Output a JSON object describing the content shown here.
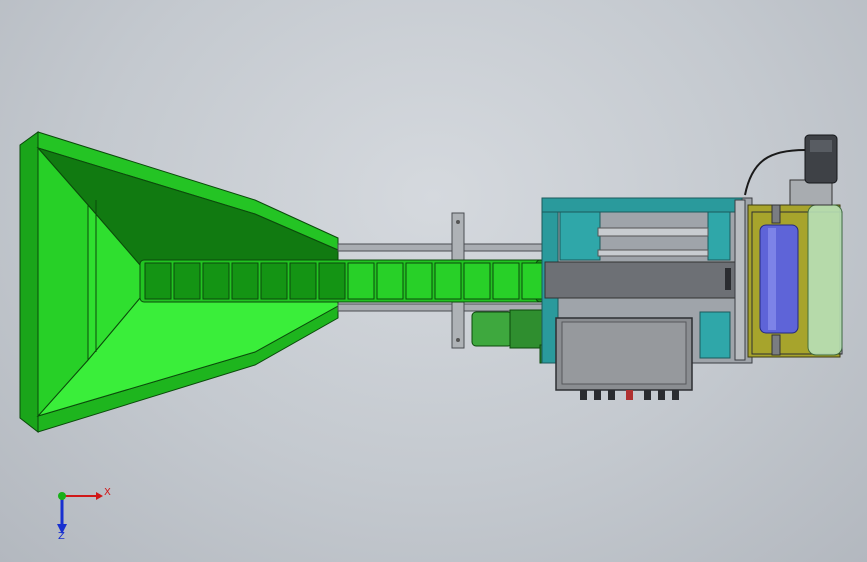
{
  "viewport": {
    "background": "#c6cbd1"
  },
  "model": {
    "hopper_color": "#1fb81f",
    "hopper_dark": "#0f6e0f",
    "hopper_light": "#39f039",
    "conveyor_color": "#22c422",
    "frame_color": "#2a9a9c",
    "motor_color": "#3c9c3c",
    "cabinet_color": "#8a8d91",
    "roller_color": "#5e64d8",
    "plate_color": "#9c9a2c"
  },
  "triad": {
    "x_label": "X",
    "z_label": "Z",
    "x_color": "#d01818",
    "y_color": "#18b018",
    "z_color": "#1830d0"
  }
}
